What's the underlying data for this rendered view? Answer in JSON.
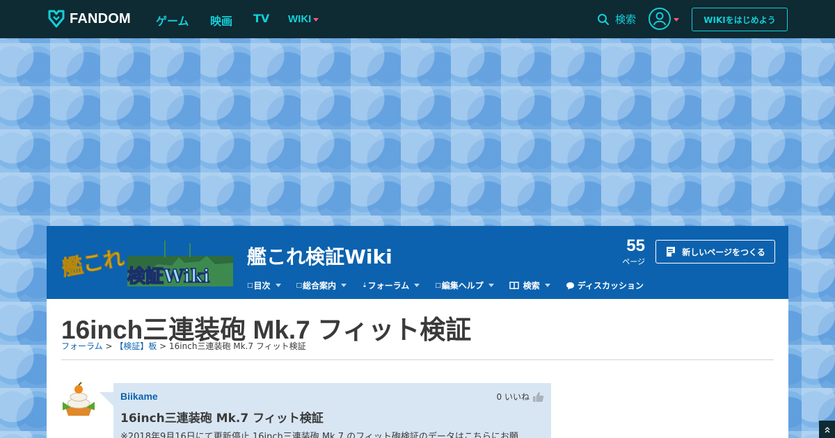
{
  "global_nav": {
    "logo_text": "FANDOM",
    "links": [
      "ゲーム",
      "映画",
      "TV",
      "WIKI"
    ],
    "search_label": "検索",
    "start_wiki_label": "WIKIをはじめよう"
  },
  "community": {
    "wiki_name": "艦これ検証Wiki",
    "logo_text_top": "艦これ",
    "logo_text_bottom": "検証Wiki",
    "page_count": "55",
    "page_count_label": "ページ",
    "new_page_label": "新しいページをつくる",
    "nav": [
      {
        "label": "目次",
        "prefix": "□"
      },
      {
        "label": "総合案内",
        "prefix": "□"
      },
      {
        "label": "フォーラム",
        "prefix": "⇣"
      },
      {
        "label": "編集ヘルプ",
        "prefix": "□"
      },
      {
        "label": "検索",
        "prefix": ""
      },
      {
        "label": "ディスカッション",
        "prefix": ""
      }
    ]
  },
  "page": {
    "title": "16inch三連装砲 Mk.7 フィット検証",
    "breadcrumb": {
      "forum": "フォーラム",
      "sep1": " > ",
      "board": "【検証】板",
      "sep2": " > ",
      "current": "16inch三連装砲 Mk.7 フィット検証"
    }
  },
  "post": {
    "author": "Biikame",
    "likes": "0 いいね",
    "title": "16inch三連装砲 Mk.7 フィット検証",
    "body": "※2018年9月16日にて更新停止 16inch三連装砲 Mk.7 のフィット砲検証のデータはこちらにお願"
  },
  "colors": {
    "global_nav_bg": "#0e2a33",
    "accent": "#13d0d8",
    "community_header_bg": "#0c62ae",
    "post_bg": "#d8e6f3"
  }
}
